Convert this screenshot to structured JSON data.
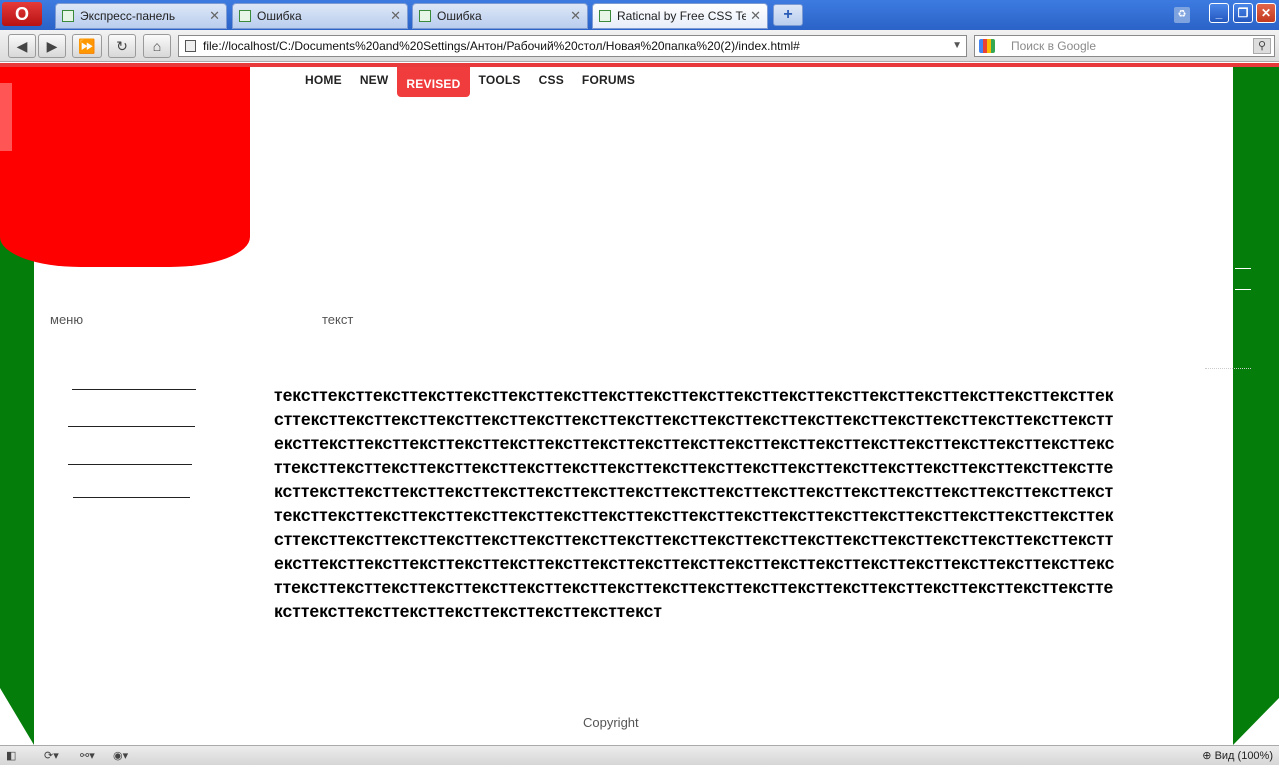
{
  "browser": {
    "tabs": [
      {
        "label": "Экспресс-панель",
        "active": false
      },
      {
        "label": "Ошибка",
        "active": false
      },
      {
        "label": "Ошибка",
        "active": false
      },
      {
        "label": "Raticnal by Free CSS Te...",
        "active": true
      }
    ],
    "address": "file://localhost/C:/Documents%20and%20Settings/Антон/Рабочий%20стол/Новая%20папка%20(2)/index.html#",
    "search_placeholder": "Поиск в Google",
    "zoom_label": "Вид (100%)"
  },
  "page": {
    "menu": [
      "HOME",
      "NEW",
      "REVISED",
      "TOOLS",
      "CSS",
      "FORUMS"
    ],
    "active_menu": "REVISED",
    "left_label": "меню",
    "content_label": "текст",
    "body_text": "тексттексттексттексттексттексттексттексттексттексттексттексттексттексттексттексттексттексттексттексттексттексттексттексттексттексттексттексттексттексттексттексттексттексттексттексттексттексттексттексттексттексттексттексттексттексттексттексттексттексттексттексттексттексттексттексттексттексттексттексттексттексттексттексттексттексттексттексттексттексттексттексттексттексттексттексттексттексттексттексттексттексттексттексттексттексттексттексттексттексттексттексттексттексттексттексттексттексттексттексттексттексттексттексттексттексттексттексттексттексттексттексттексттексттексттексттексттексттексттексттексттексттексттексттексттексттексттексттексттексттексттексттексттексттексттексттексттексттексттексттексттексттексттексттексттексттексттексттексттексттексттексттексттексттексттексттексттексттексттексттексттексттексттексттексттексттексттексттексттексттексттексттексттексттексттекст",
    "copyright": "Copyright"
  },
  "colors": {
    "accent_red": "#ff0000",
    "menu_active": "#f03c3c",
    "side_green": "#047d0a"
  }
}
